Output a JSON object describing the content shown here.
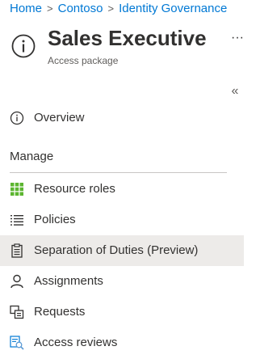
{
  "breadcrumb": {
    "items": [
      "Home",
      "Contoso",
      "Identity Governance"
    ]
  },
  "header": {
    "title": "Sales Executive",
    "subtitle": "Access package",
    "more_label": "···",
    "collapse_label": "«"
  },
  "nav": {
    "overview": "Overview",
    "manage_heading": "Manage",
    "items": [
      {
        "label": "Resource roles",
        "icon": "grid-icon"
      },
      {
        "label": "Policies",
        "icon": "list-icon"
      },
      {
        "label": "Separation of Duties (Preview)",
        "icon": "clipboard-icon",
        "selected": true
      },
      {
        "label": "Assignments",
        "icon": "person-icon"
      },
      {
        "label": "Requests",
        "icon": "requests-icon"
      },
      {
        "label": "Access reviews",
        "icon": "access-review-icon"
      }
    ]
  },
  "colors": {
    "link": "#0078d4",
    "selected_bg": "#edebe9",
    "grid_icon": "#5cb531"
  }
}
